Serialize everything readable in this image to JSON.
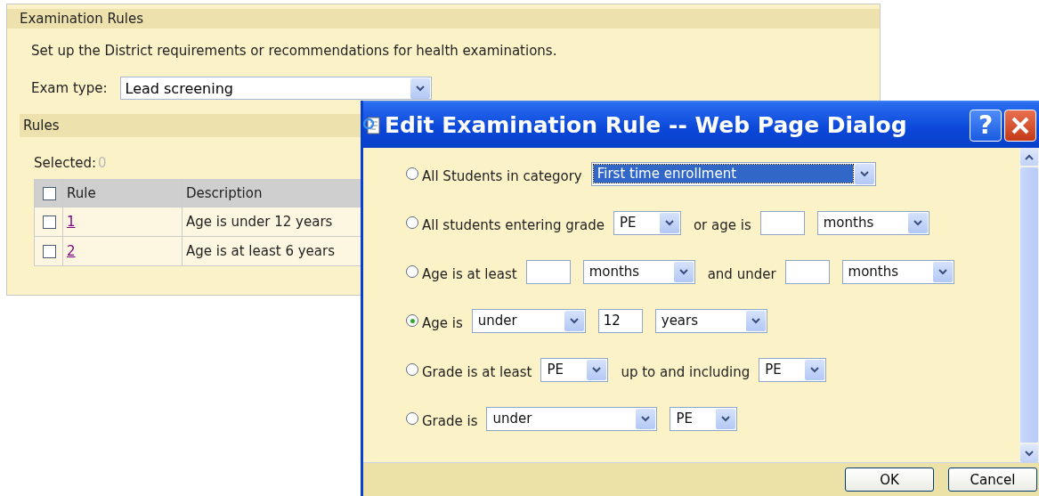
{
  "panel": {
    "title": "Examination Rules",
    "description": "Set up the District requirements or recommendations for health examinations.",
    "exam_type_label": "Exam type:",
    "exam_type_value": "Lead screening",
    "rules_title": "Rules",
    "selected_label": "Selected:",
    "selected_count": "0",
    "table": {
      "columns": [
        "Rule",
        "Description"
      ],
      "header_checked": false,
      "rows": [
        {
          "checked": false,
          "rule": "1",
          "description": "Age is under 12 years"
        },
        {
          "checked": false,
          "rule": "2",
          "description": "Age is at least 6 years"
        }
      ]
    }
  },
  "dialog": {
    "title": "Edit Examination Rule -- Web Page Dialog",
    "help": "?",
    "rows": [
      {
        "selected": false,
        "parts": [
          {
            "kind": "text",
            "text": "All Students in category"
          },
          {
            "kind": "select",
            "value": "First time enrollment",
            "focused": true
          }
        ]
      },
      {
        "selected": false,
        "parts": [
          {
            "kind": "text",
            "text": "All students entering grade"
          },
          {
            "kind": "select",
            "value": "PE",
            "focused": false
          },
          {
            "kind": "text",
            "text": "or age is"
          },
          {
            "kind": "field"
          },
          {
            "kind": "select",
            "value": "months",
            "focused": false
          }
        ]
      },
      {
        "selected": false,
        "parts": [
          {
            "kind": "text",
            "text": "Age is at least"
          },
          {
            "kind": "field"
          },
          {
            "kind": "select",
            "value": "months",
            "focused": false
          },
          {
            "kind": "text",
            "text": "and under"
          },
          {
            "kind": "field"
          },
          {
            "kind": "select",
            "value": "months",
            "focused": false
          }
        ]
      },
      {
        "selected": true,
        "parts": [
          {
            "kind": "text",
            "text": "Age is"
          },
          {
            "kind": "select",
            "value": "under",
            "focused": false
          },
          {
            "kind": "field",
            "value": "12"
          },
          {
            "kind": "select",
            "value": "years",
            "focused": false
          }
        ]
      },
      {
        "selected": false,
        "parts": [
          {
            "kind": "text",
            "text": "Grade is at least"
          },
          {
            "kind": "select",
            "value": "PE",
            "focused": false
          },
          {
            "kind": "text",
            "text": "up to and including"
          },
          {
            "kind": "select",
            "value": "PE",
            "focused": false
          }
        ]
      },
      {
        "selected": false,
        "parts": [
          {
            "kind": "text",
            "text": "Grade is"
          },
          {
            "kind": "select",
            "value": "under",
            "focused": false
          },
          {
            "kind": "select",
            "value": "PE",
            "focused": false
          }
        ]
      }
    ],
    "buttons": [
      "OK",
      "Cancel"
    ]
  }
}
